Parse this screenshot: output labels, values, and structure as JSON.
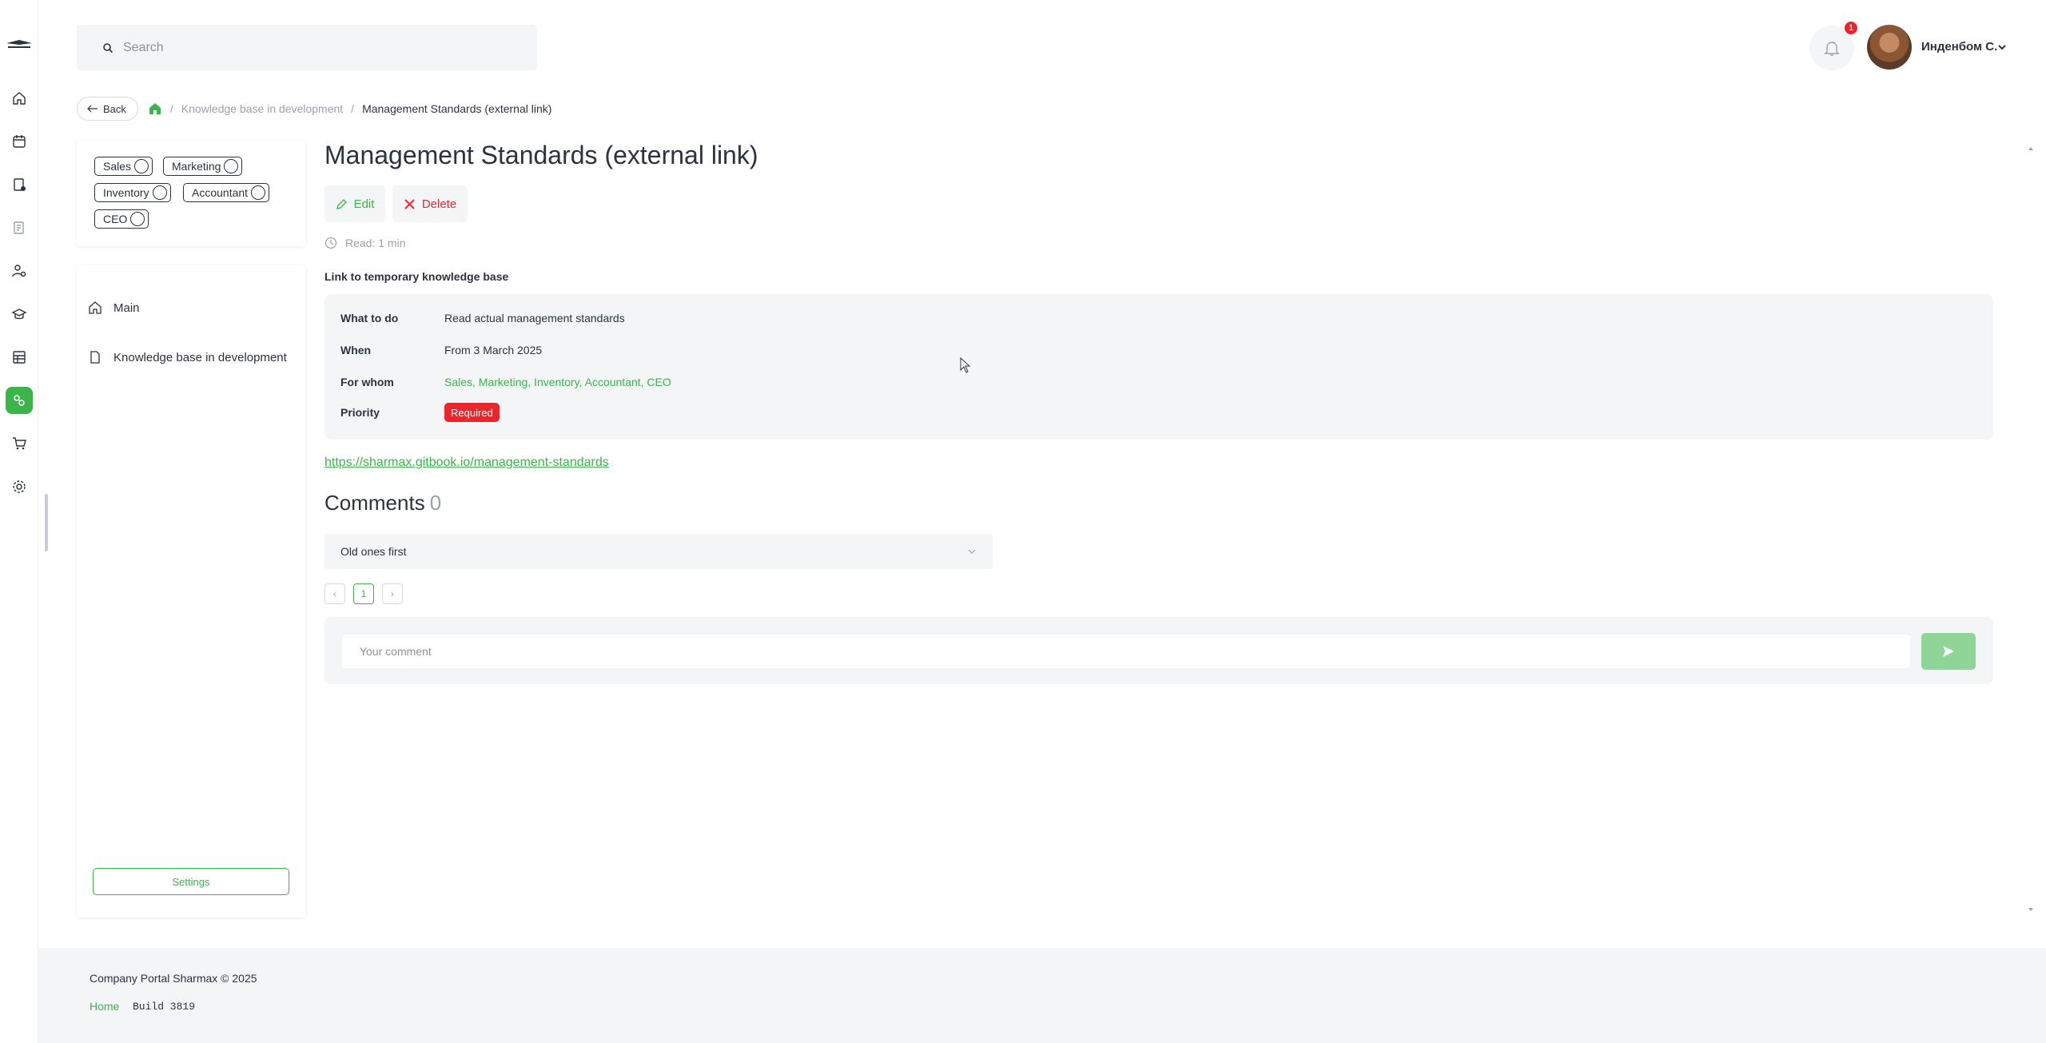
{
  "search": {
    "placeholder": "Search"
  },
  "header": {
    "notifications_count": "1",
    "user_name": "Инденбом С."
  },
  "breadcrumb": {
    "back_label": "Back",
    "items": [
      "Knowledge base in development",
      "Management Standards (external link)"
    ],
    "separator": "/"
  },
  "tags": [
    "Sales",
    "Marketing",
    "Inventory",
    "Accountant",
    "CEO"
  ],
  "nav": {
    "items": [
      {
        "label": "Main",
        "icon": "home-icon"
      },
      {
        "label": "Knowledge base in development",
        "icon": "document-icon"
      }
    ],
    "settings_label": "Settings"
  },
  "article": {
    "title": "Management Standards (external link)",
    "edit_label": "Edit",
    "delete_label": "Delete",
    "read_time": "Read: 1 min",
    "subheading": "Link to temporary knowledge base",
    "details": [
      {
        "label": "What to do",
        "value": "Read actual management standards"
      },
      {
        "label": "When",
        "value": "From 3 March 2025"
      },
      {
        "label": "For whom",
        "value": "Sales, Marketing, Inventory, Accountant, CEO"
      },
      {
        "label": "Priority",
        "value": "Required"
      }
    ],
    "link": "https://sharmax.gitbook.io/management-standards"
  },
  "comments": {
    "heading": "Comments",
    "count": "0",
    "sort_value": "Old ones first",
    "pagination": {
      "prev": "‹",
      "current": "1",
      "next": "›"
    },
    "input_placeholder": "Your comment"
  },
  "footer": {
    "copyright": "Company Portal Sharmax © 2025",
    "home_link": "Home",
    "build": "Build 3819"
  },
  "colors": {
    "accent": "#3bb44a",
    "danger": "#e8262b",
    "text": "#2b3240",
    "muted": "#9aa1ab",
    "panel": "#f4f5f7"
  },
  "rail_icons": [
    "home-icon",
    "calendar-icon",
    "tasks-icon",
    "reports-icon",
    "users-settings-icon",
    "education-icon",
    "table-icon",
    "knowledge-icon",
    "cart-icon",
    "gear-icon"
  ]
}
